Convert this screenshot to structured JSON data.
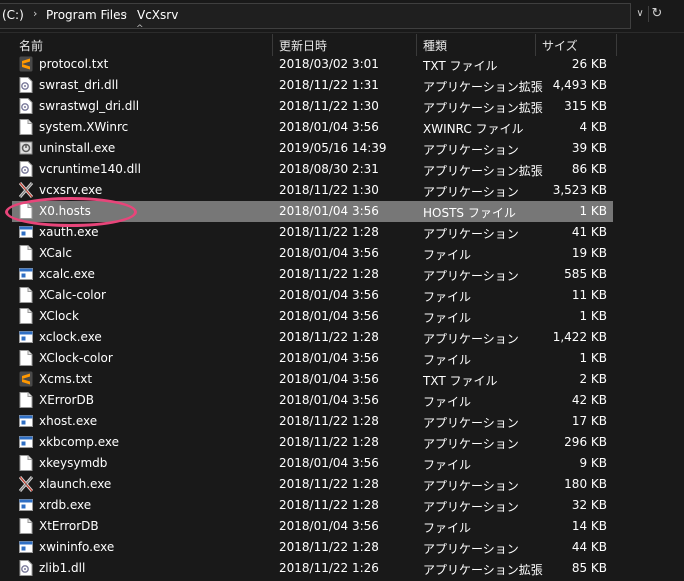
{
  "address": {
    "crumbs": [
      "(C:)",
      "Program Files",
      "VcXsrv"
    ],
    "sep": "›",
    "dropdown": "∨",
    "refresh": "↻"
  },
  "header": {
    "name": "名前",
    "date": "更新日時",
    "type": "種類",
    "size": "サイズ",
    "sort": "^"
  },
  "files": [
    {
      "name": "protocol.txt",
      "date": "2018/03/02 3:01",
      "type": "TXT ファイル",
      "size": "26 KB",
      "icon": "sublime-icon"
    },
    {
      "name": "swrast_dri.dll",
      "date": "2018/11/22 1:31",
      "type": "アプリケーション拡張",
      "size": "4,493 KB",
      "icon": "dll-icon"
    },
    {
      "name": "swrastwgl_dri.dll",
      "date": "2018/11/22 1:30",
      "type": "アプリケーション拡張",
      "size": "315 KB",
      "icon": "dll-icon"
    },
    {
      "name": "system.XWinrc",
      "date": "2018/01/04 3:56",
      "type": "XWINRC ファイル",
      "size": "4 KB",
      "icon": "file-icon"
    },
    {
      "name": "uninstall.exe",
      "date": "2019/05/16 14:39",
      "type": "アプリケーション",
      "size": "39 KB",
      "icon": "uninstall-icon"
    },
    {
      "name": "vcruntime140.dll",
      "date": "2018/08/30 2:31",
      "type": "アプリケーション拡張",
      "size": "86 KB",
      "icon": "dll-icon"
    },
    {
      "name": "vcxsrv.exe",
      "date": "2018/11/22 1:30",
      "type": "アプリケーション",
      "size": "3,523 KB",
      "icon": "x-icon"
    },
    {
      "name": "X0.hosts",
      "date": "2018/01/04 3:56",
      "type": "HOSTS ファイル",
      "size": "1 KB",
      "icon": "file-icon"
    },
    {
      "name": "xauth.exe",
      "date": "2018/11/22 1:28",
      "type": "アプリケーション",
      "size": "41 KB",
      "icon": "exe-icon"
    },
    {
      "name": "XCalc",
      "date": "2018/01/04 3:56",
      "type": "ファイル",
      "size": "19 KB",
      "icon": "file-icon"
    },
    {
      "name": "xcalc.exe",
      "date": "2018/11/22 1:28",
      "type": "アプリケーション",
      "size": "585 KB",
      "icon": "exe-icon"
    },
    {
      "name": "XCalc-color",
      "date": "2018/01/04 3:56",
      "type": "ファイル",
      "size": "11 KB",
      "icon": "file-icon"
    },
    {
      "name": "XClock",
      "date": "2018/01/04 3:56",
      "type": "ファイル",
      "size": "1 KB",
      "icon": "file-icon"
    },
    {
      "name": "xclock.exe",
      "date": "2018/11/22 1:28",
      "type": "アプリケーション",
      "size": "1,422 KB",
      "icon": "exe-icon"
    },
    {
      "name": "XClock-color",
      "date": "2018/01/04 3:56",
      "type": "ファイル",
      "size": "1 KB",
      "icon": "file-icon"
    },
    {
      "name": "Xcms.txt",
      "date": "2018/01/04 3:56",
      "type": "TXT ファイル",
      "size": "2 KB",
      "icon": "sublime-icon"
    },
    {
      "name": "XErrorDB",
      "date": "2018/01/04 3:56",
      "type": "ファイル",
      "size": "42 KB",
      "icon": "file-icon"
    },
    {
      "name": "xhost.exe",
      "date": "2018/11/22 1:28",
      "type": "アプリケーション",
      "size": "17 KB",
      "icon": "exe-icon"
    },
    {
      "name": "xkbcomp.exe",
      "date": "2018/11/22 1:28",
      "type": "アプリケーション",
      "size": "296 KB",
      "icon": "exe-icon"
    },
    {
      "name": "xkeysymdb",
      "date": "2018/01/04 3:56",
      "type": "ファイル",
      "size": "9 KB",
      "icon": "file-icon"
    },
    {
      "name": "xlaunch.exe",
      "date": "2018/11/22 1:28",
      "type": "アプリケーション",
      "size": "180 KB",
      "icon": "x-icon"
    },
    {
      "name": "xrdb.exe",
      "date": "2018/11/22 1:28",
      "type": "アプリケーション",
      "size": "32 KB",
      "icon": "exe-icon"
    },
    {
      "name": "XtErrorDB",
      "date": "2018/01/04 3:56",
      "type": "ファイル",
      "size": "14 KB",
      "icon": "file-icon"
    },
    {
      "name": "xwininfo.exe",
      "date": "2018/11/22 1:28",
      "type": "アプリケーション",
      "size": "44 KB",
      "icon": "exe-icon"
    },
    {
      "name": "zlib1.dll",
      "date": "2018/11/22 1:26",
      "type": "アプリケーション拡張",
      "size": "85 KB",
      "icon": "dll-icon"
    }
  ],
  "selected_index": 7,
  "colors": {
    "background": "#191919",
    "selection": "#777777",
    "highlight": "#e8457a"
  }
}
